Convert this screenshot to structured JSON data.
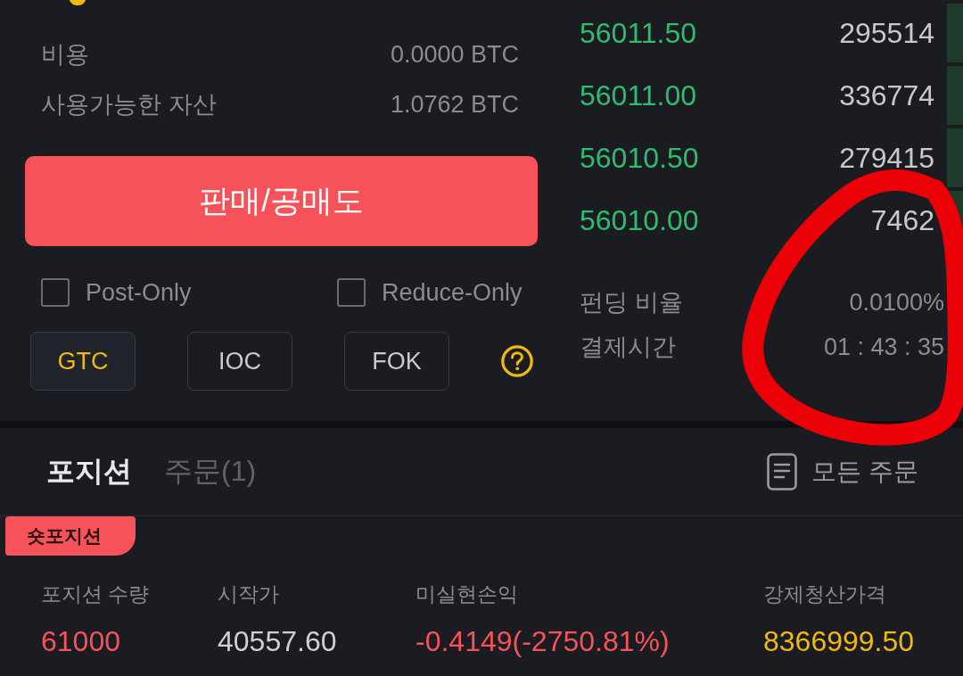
{
  "order_form": {
    "fee": {
      "label": "비용",
      "value": "0.0000 BTC"
    },
    "available": {
      "label": "사용가능한 자산",
      "value": "1.0762 BTC"
    },
    "submit_button": "판매/공매도",
    "options": [
      {
        "label": "Post-Only",
        "checked": false
      },
      {
        "label": "Reduce-Only",
        "checked": false
      }
    ],
    "time_in_force": [
      {
        "label": "GTC",
        "selected": true
      },
      {
        "label": "IOC",
        "selected": false
      },
      {
        "label": "FOK",
        "selected": false
      }
    ]
  },
  "order_book": {
    "buy_side": true,
    "rows": [
      {
        "price": "56011.50",
        "quantity": "295514"
      },
      {
        "price": "56011.00",
        "quantity": "336774"
      },
      {
        "price": "56010.50",
        "quantity": "279415"
      },
      {
        "price": "56010.00",
        "quantity": "7462"
      }
    ]
  },
  "funding": [
    {
      "label": "펀딩 비율",
      "value": "0.0100%"
    },
    {
      "label": "결제시간",
      "value": "01 : 43 : 35"
    }
  ],
  "positions_panel": {
    "tabs": [
      {
        "label": "포지션",
        "selected": true
      },
      {
        "label": "주문(1)",
        "selected": false
      }
    ],
    "all_orders_link": "모든 주문",
    "position": {
      "short": true,
      "tag": "숏포지션",
      "fields": [
        {
          "label": "포지션 수량",
          "value": "61000",
          "color": "#f6525a"
        },
        {
          "label": "시작가",
          "value": "40557.60",
          "color": "#cfd0d3"
        },
        {
          "label": "미실현손익",
          "value": "-0.4149(-2750.81%)",
          "color": "#f6525a"
        },
        {
          "label": "강제청산가격",
          "value": "8366999.50",
          "color": "#f0b90b"
        }
      ]
    }
  }
}
